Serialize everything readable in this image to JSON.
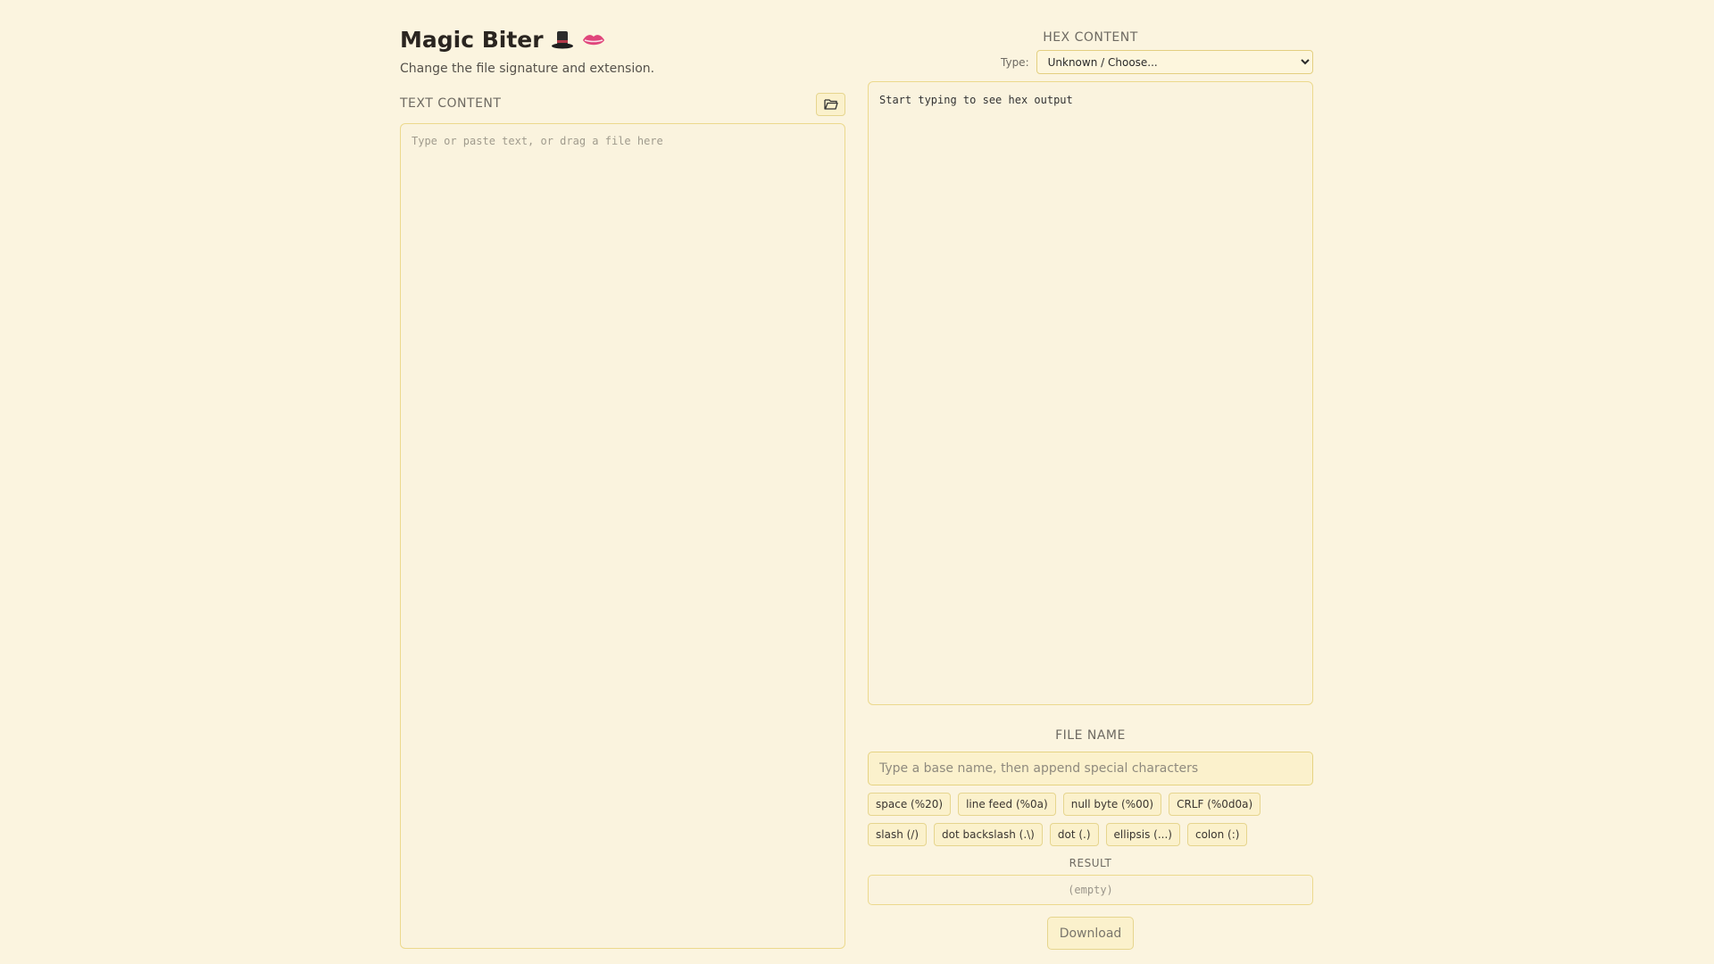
{
  "header": {
    "title": "Magic Biter",
    "title_icons": [
      "top-hat-icon",
      "lips-icon"
    ],
    "subtitle": "Change the file signature and extension."
  },
  "text_panel": {
    "label": "TEXT CONTENT",
    "placeholder": "Type or paste text, or drag a file here",
    "value": "",
    "open_file_icon": "folder-open-icon"
  },
  "hex_panel": {
    "label": "HEX CONTENT",
    "type_label": "Type:",
    "type_selected": "Unknown / Choose...",
    "output": "Start typing to see hex output"
  },
  "file_name": {
    "label": "FILE NAME",
    "placeholder": "Type a base name, then append special characters",
    "value": "",
    "chips_row1": [
      "space (%20)",
      "line feed (%0a)",
      "null byte (%00)",
      "CRLF (%0d0a)"
    ],
    "chips_row2": [
      "slash (/)",
      "dot backslash (.\\)",
      "dot (.)",
      "ellipsis (...)",
      "colon (:)"
    ]
  },
  "result": {
    "label": "RESULT",
    "value": "(empty)"
  },
  "download": {
    "label": "Download"
  },
  "colors": {
    "background": "#fbf4df",
    "border": "#ecd98d",
    "chip_bg": "#fbf1cc"
  }
}
